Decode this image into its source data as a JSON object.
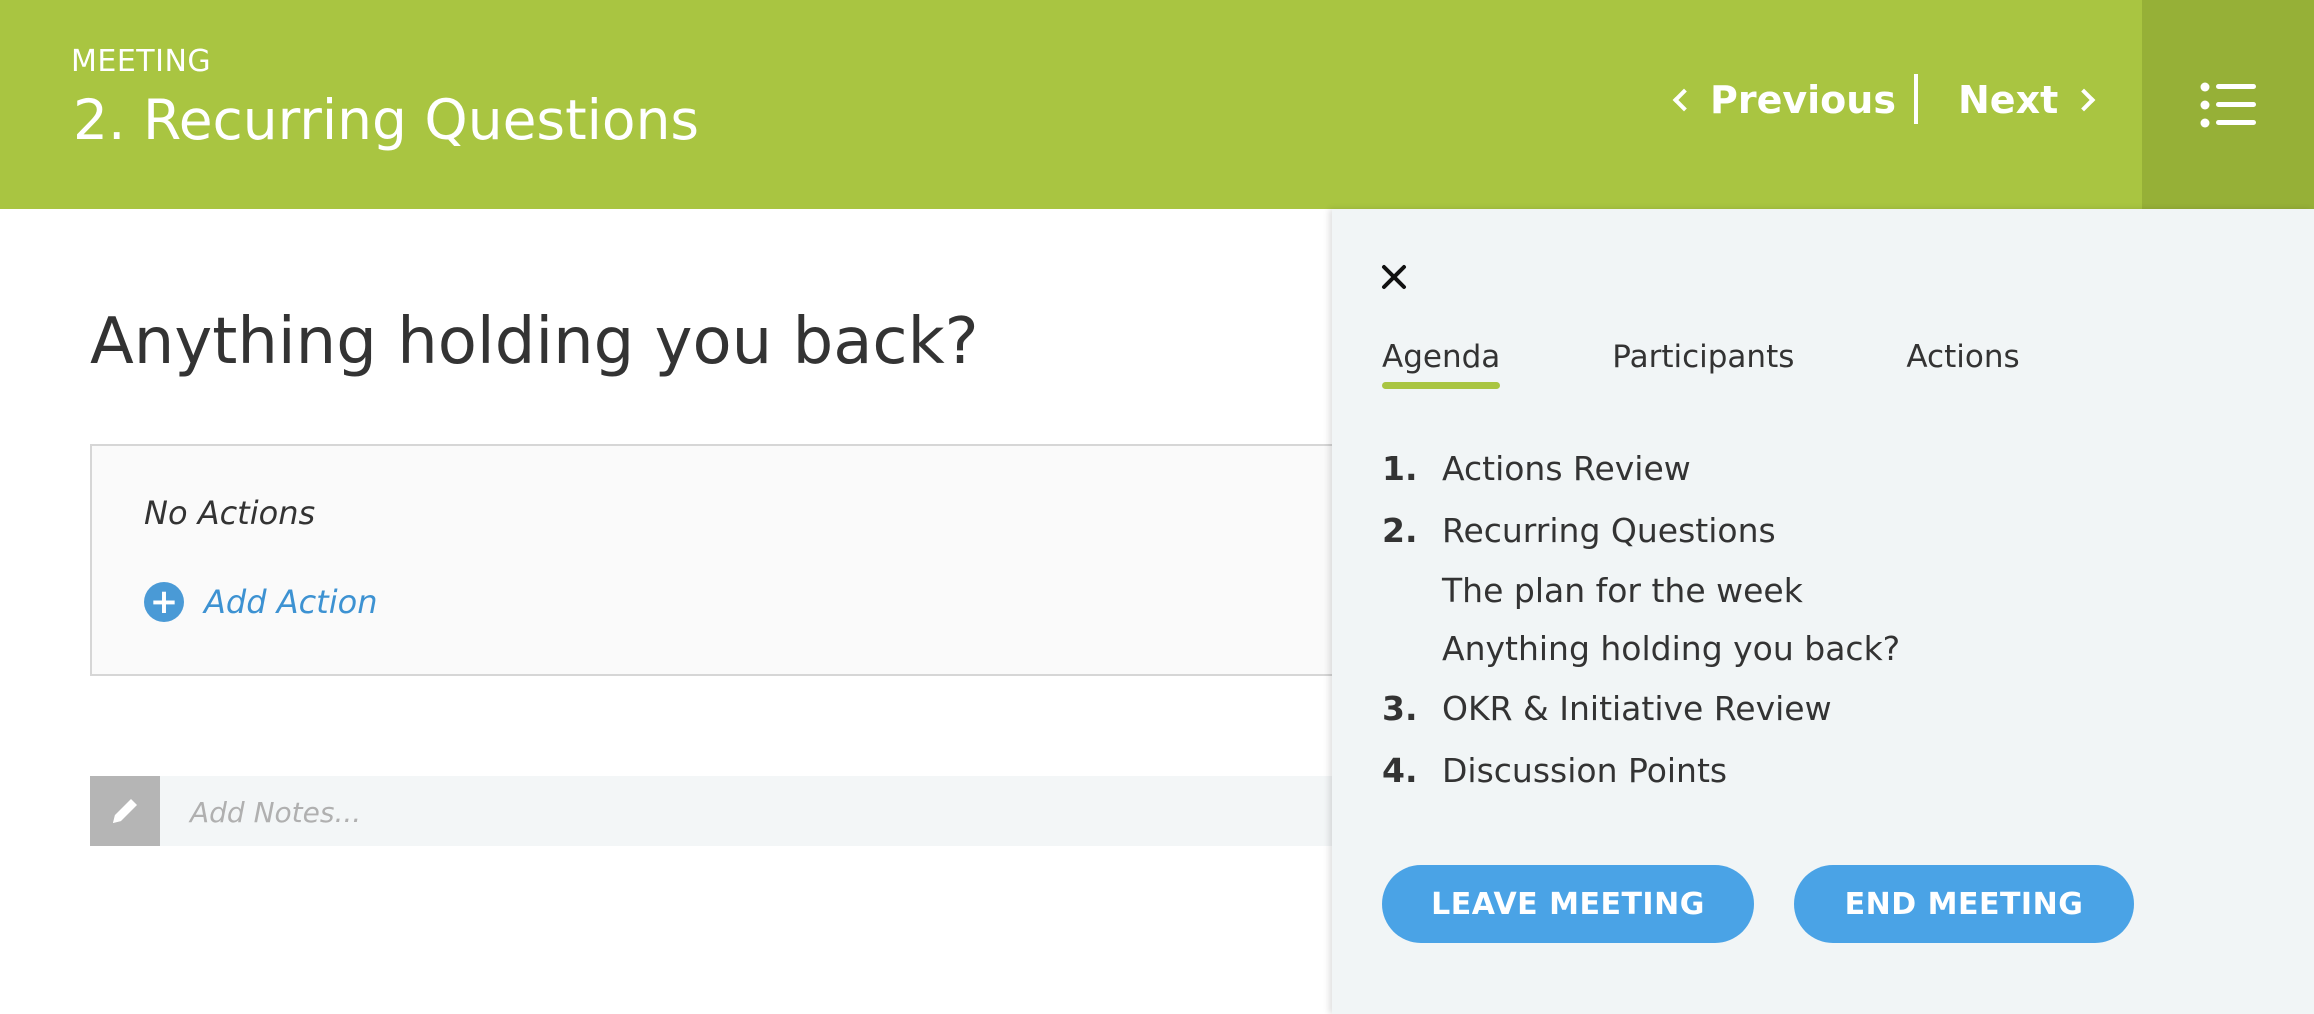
{
  "header": {
    "kicker": "MEETING",
    "title": "2. Recurring Questions",
    "previous_label": "Previous",
    "next_label": "Next",
    "menu_icon": "list-icon",
    "background": "#a9c541"
  },
  "main": {
    "question": "Anything holding you back?",
    "no_actions": "No Actions",
    "add_action_label": "Add Action",
    "notes_placeholder": "Add Notes..."
  },
  "panel": {
    "close_icon": "close-icon",
    "tabs": [
      {
        "label": "Agenda",
        "active": true
      },
      {
        "label": "Participants",
        "active": false
      },
      {
        "label": "Actions",
        "active": false
      }
    ],
    "agenda": [
      {
        "num": "1.",
        "label": "Actions Review"
      },
      {
        "num": "2.",
        "label": "Recurring Questions",
        "sub": [
          "The plan for the week",
          "Anything holding you back?"
        ]
      },
      {
        "num": "3.",
        "label": "OKR & Initiative Review"
      },
      {
        "num": "4.",
        "label": "Discussion Points"
      }
    ],
    "leave_label": "LEAVE MEETING",
    "end_label": "END MEETING"
  },
  "colors": {
    "brand_green": "#a9c541",
    "accent_blue": "#4aa3e6"
  }
}
